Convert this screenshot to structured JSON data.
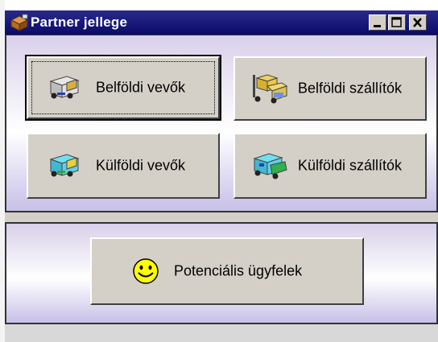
{
  "window": {
    "title": "Partner jellege",
    "controls": {
      "minimize": "_",
      "maximize": "□",
      "close": "✕"
    }
  },
  "buttons": {
    "domestic_customers": "Belföldi vevők",
    "domestic_suppliers": "Belföldi szállítók",
    "foreign_customers": "Külföldi vevők",
    "foreign_suppliers": "Külföldi szállítók",
    "potential_clients": "Potenciális ügyfelek"
  },
  "icons": {
    "app": "package-icon",
    "domestic_customers": "truck-icon",
    "domestic_suppliers": "forklift-icon",
    "foreign_customers": "truck-icon",
    "foreign_suppliers": "truck-icon",
    "potential_clients": "smiley-icon"
  },
  "colors": {
    "titlebar": "#0a0a6a",
    "button_face": "#d4d0c8",
    "panel_tint": "#c8c0e8"
  }
}
